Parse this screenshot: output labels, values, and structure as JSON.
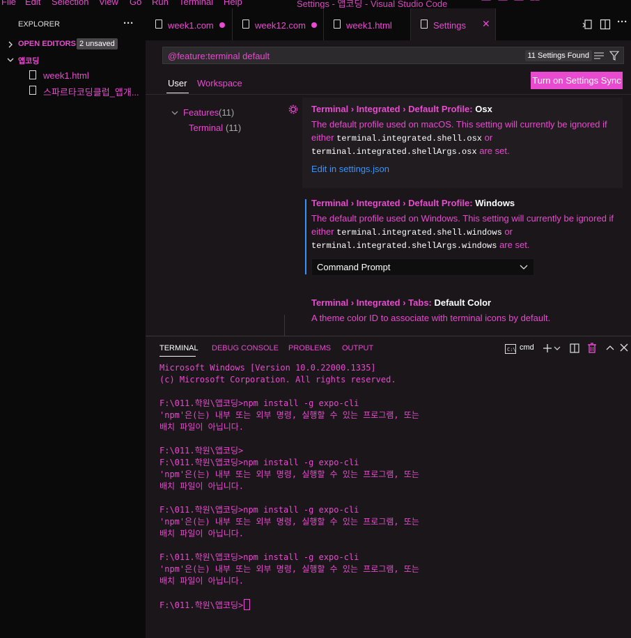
{
  "window": {
    "title": "Settings - 앱코딩 - Visual Studio Code",
    "menu": [
      "File",
      "Edit",
      "Selection",
      "View",
      "Go",
      "Run",
      "Terminal",
      "Help"
    ]
  },
  "sidebar": {
    "header": "EXPLORER",
    "more": "···",
    "open_editors": {
      "label": "OPEN EDITORS",
      "badge": "2 unsaved"
    },
    "folder": "앱코딩",
    "files": [
      "week1.html",
      "스파르타코딩클럽_앱개..."
    ]
  },
  "tabs": [
    {
      "label": "week1.com",
      "modified": true
    },
    {
      "label": "week12.com",
      "modified": true
    },
    {
      "label": "week1.html",
      "modified": false
    },
    {
      "label": "Settings",
      "active": true,
      "close": "✕"
    }
  ],
  "settings": {
    "search_value": "@feature:terminal default",
    "found": "11 Settings Found",
    "scopes": [
      "User",
      "Workspace"
    ],
    "sync_button": "Turn on Settings Sync",
    "toc": {
      "features": "Features",
      "features_count": "(11)",
      "terminal": "Terminal",
      "terminal_count": "(11)"
    },
    "items": [
      {
        "category": "Terminal › Integrated › Default Profile: ",
        "name": "Osx",
        "desc_1": "The default profile used on macOS. This setting will currently be ignored if either ",
        "code_1": "terminal.integrated.shell.osx",
        "desc_2": " or ",
        "code_2": "terminal.integrated.shellArgs.osx",
        "desc_3": " are set.",
        "link": "Edit in settings.json"
      },
      {
        "category": "Terminal › Integrated › Default Profile: ",
        "name": "Windows",
        "desc_1": "The default profile used on Windows. This setting will currently be ignored if either ",
        "code_1": "terminal.integrated.shell.windows",
        "desc_2": " or ",
        "code_2": "terminal.integrated.shellArgs.windows",
        "desc_3": " are set.",
        "select_value": "Command Prompt"
      },
      {
        "category": "Terminal › Integrated › Tabs: ",
        "name": "Default Color",
        "desc_1": "A theme color ID to associate with terminal icons by default."
      }
    ]
  },
  "panel": {
    "tabs": [
      "TERMINAL",
      "DEBUG CONSOLE",
      "PROBLEMS",
      "OUTPUT"
    ],
    "shell": "cmd",
    "terminal_text": "Microsoft Windows [Version 10.0.22000.1335]\n(c) Microsoft Corporation. All rights reserved.\n\nF:\\011.학원\\앱코딩>npm install -g expo-cli\n'npm'은(는) 내부 또는 외부 명령, 실행할 수 있는 프로그램, 또는\n배치 파일이 아닙니다.\n\nF:\\011.학원\\앱코딩>\nF:\\011.학원\\앱코딩>npm install -g expo-cli\n'npm'은(는) 내부 또는 외부 명령, 실행할 수 있는 프로그램, 또는\n배치 파일이 아닙니다.\n\nF:\\011.학원\\앱코딩>npm install -g expo-cli\n'npm'은(는) 내부 또는 외부 명령, 실행할 수 있는 프로그램, 또는\n배치 파일이 아닙니다.\n\nF:\\011.학원\\앱코딩>npm install -g expo-cli\n'npm'은(는) 내부 또는 외부 명령, 실행할 수 있는 프로그램, 또는\n배치 파일이 아닙니다.\n\nF:\\011.학원\\앱코딩>"
  }
}
